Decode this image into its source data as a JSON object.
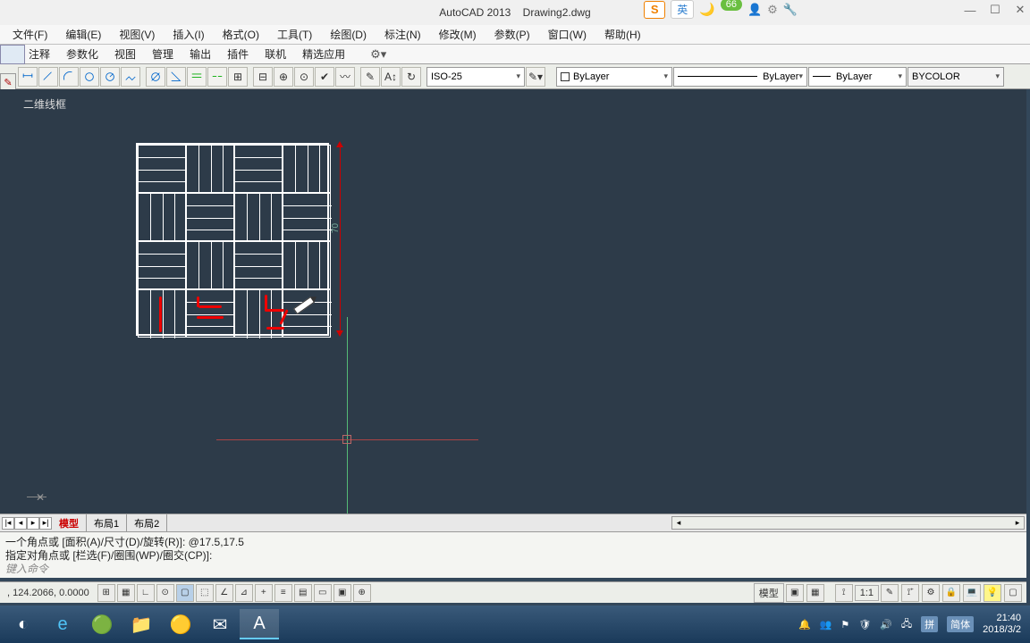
{
  "title": {
    "app": "AutoCAD 2013",
    "file": "Drawing2.dwg"
  },
  "title_badges": {
    "lang": "英",
    "score": "66",
    "s": "S"
  },
  "menu": {
    "file": "文件(F)",
    "edit": "编辑(E)",
    "view": "视图(V)",
    "insert": "插入(I)",
    "format": "格式(O)",
    "tools": "工具(T)",
    "draw": "绘图(D)",
    "dimension": "标注(N)",
    "modify": "修改(M)",
    "param": "参数(P)",
    "window": "窗口(W)",
    "help": "帮助(H)"
  },
  "ribbon": {
    "annotate": "注释",
    "parametric": "参数化",
    "view": "视图",
    "manage": "管理",
    "output": "输出",
    "plugins": "插件",
    "online": "联机",
    "featured": "精选应用"
  },
  "toolbar": {
    "dim_style": "ISO-25",
    "layer": "ByLayer",
    "linetype": "ByLayer",
    "lineweight": "ByLayer",
    "color": "BYCOLOR"
  },
  "viewport": {
    "label": "二维线框",
    "dim_value": "70"
  },
  "tabs": {
    "model": "模型",
    "layout1": "布局1",
    "layout2": "布局2"
  },
  "cmd": {
    "line1": "一个角点或 [面积(A)/尺寸(D)/旋转(R)]: @17.5,17.5",
    "line2": "指定对角点或 [栏选(F)/圈围(WP)/圈交(CP)]:",
    "prompt": "键入命令"
  },
  "status": {
    "coord": ", 124.2066, 0.0000",
    "model": "模型",
    "scale": "1:1"
  },
  "taskbar": {
    "tray": {
      "pinyin": "拼",
      "input": "简体",
      "time": "21:40",
      "date": "2018/3/2"
    }
  }
}
